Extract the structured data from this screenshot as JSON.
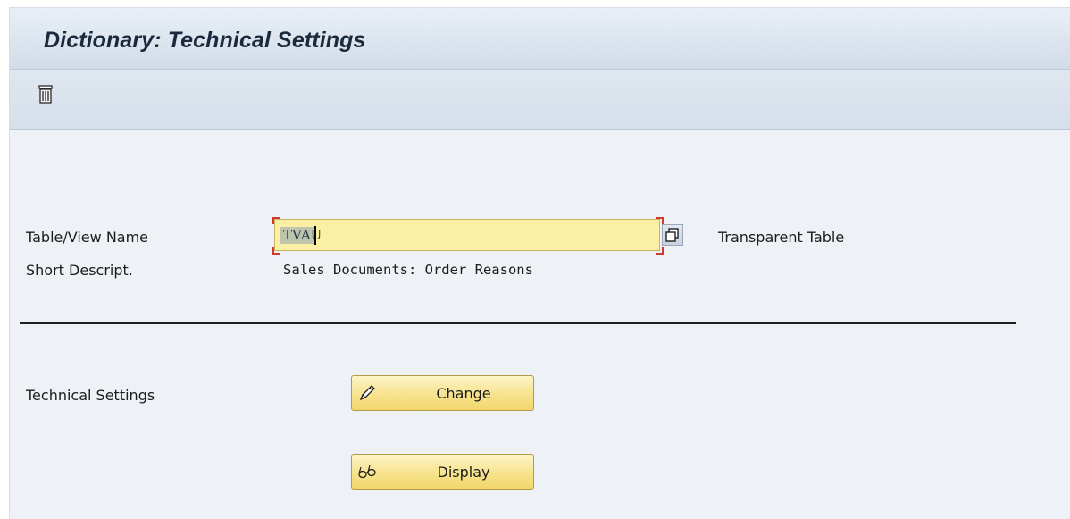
{
  "window": {
    "title": "Dictionary: Technical Settings"
  },
  "toolbar": {
    "icons": [
      "delete-icon"
    ]
  },
  "form": {
    "table_view_name": {
      "label": "Table/View Name",
      "value": "TVAU",
      "type_text": "Transparent Table"
    },
    "short_description": {
      "label": "Short Descript.",
      "value": "Sales Documents: Order Reasons"
    },
    "technical_settings": {
      "label": "Technical Settings",
      "change_label": "Change",
      "display_label": "Display"
    }
  },
  "colors": {
    "title_bar": "#dbe4ee",
    "toolbar": "#d6e0ea",
    "content_background": "#eef2f6",
    "input_highlight": "#fbefa4",
    "button_fill": "#f7e38d",
    "required_marker": "#d0392b"
  },
  "icons": {
    "delete": "trash-icon",
    "copy": "copy-icon",
    "change": "pencil-icon",
    "display": "glasses-icon"
  }
}
